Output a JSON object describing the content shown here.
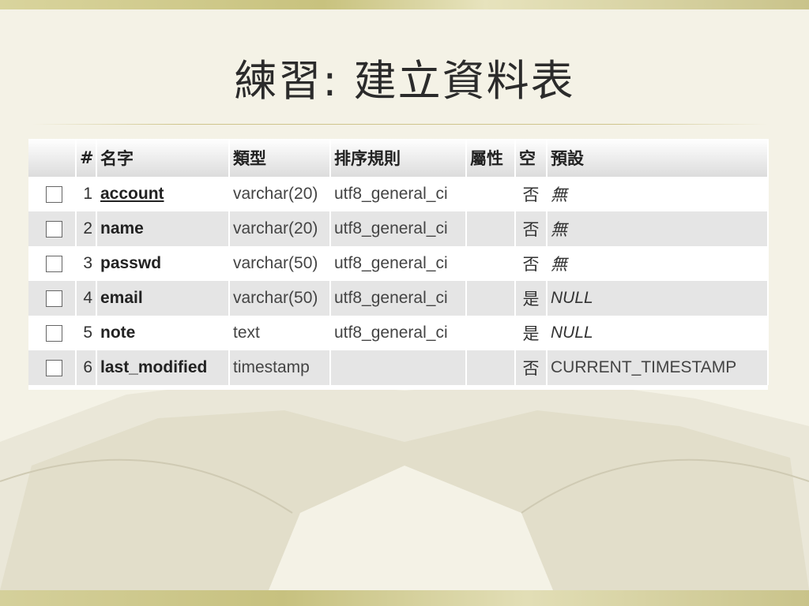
{
  "slide": {
    "title": "練習: 建立資料表"
  },
  "table": {
    "headers": {
      "number": "#",
      "name": "名字",
      "type": "類型",
      "collation": "排序規則",
      "attributes": "屬性",
      "null": "空",
      "default": "預設"
    },
    "rows": [
      {
        "number": "1",
        "name": "account",
        "type": "varchar(20)",
        "collation": "utf8_general_ci",
        "attributes": "",
        "null": "否",
        "default": "無",
        "is_link": true
      },
      {
        "number": "2",
        "name": "name",
        "type": "varchar(20)",
        "collation": "utf8_general_ci",
        "attributes": "",
        "null": "否",
        "default": "無",
        "is_link": false
      },
      {
        "number": "3",
        "name": "passwd",
        "type": "varchar(50)",
        "collation": "utf8_general_ci",
        "attributes": "",
        "null": "否",
        "default": "無",
        "is_link": false
      },
      {
        "number": "4",
        "name": "email",
        "type": "varchar(50)",
        "collation": "utf8_general_ci",
        "attributes": "",
        "null": "是",
        "default": "NULL",
        "is_link": false
      },
      {
        "number": "5",
        "name": "note",
        "type": "text",
        "collation": "utf8_general_ci",
        "attributes": "",
        "null": "是",
        "default": "NULL",
        "is_link": false
      },
      {
        "number": "6",
        "name": "last_modified",
        "type": "timestamp",
        "collation": "",
        "attributes": "",
        "null": "否",
        "default": "CURRENT_TIMESTAMP",
        "is_link": false
      }
    ]
  },
  "colors": {
    "background": "#f4f2e6",
    "accent_bar": "#c8c27e",
    "row_alt": "#e5e5e5"
  }
}
